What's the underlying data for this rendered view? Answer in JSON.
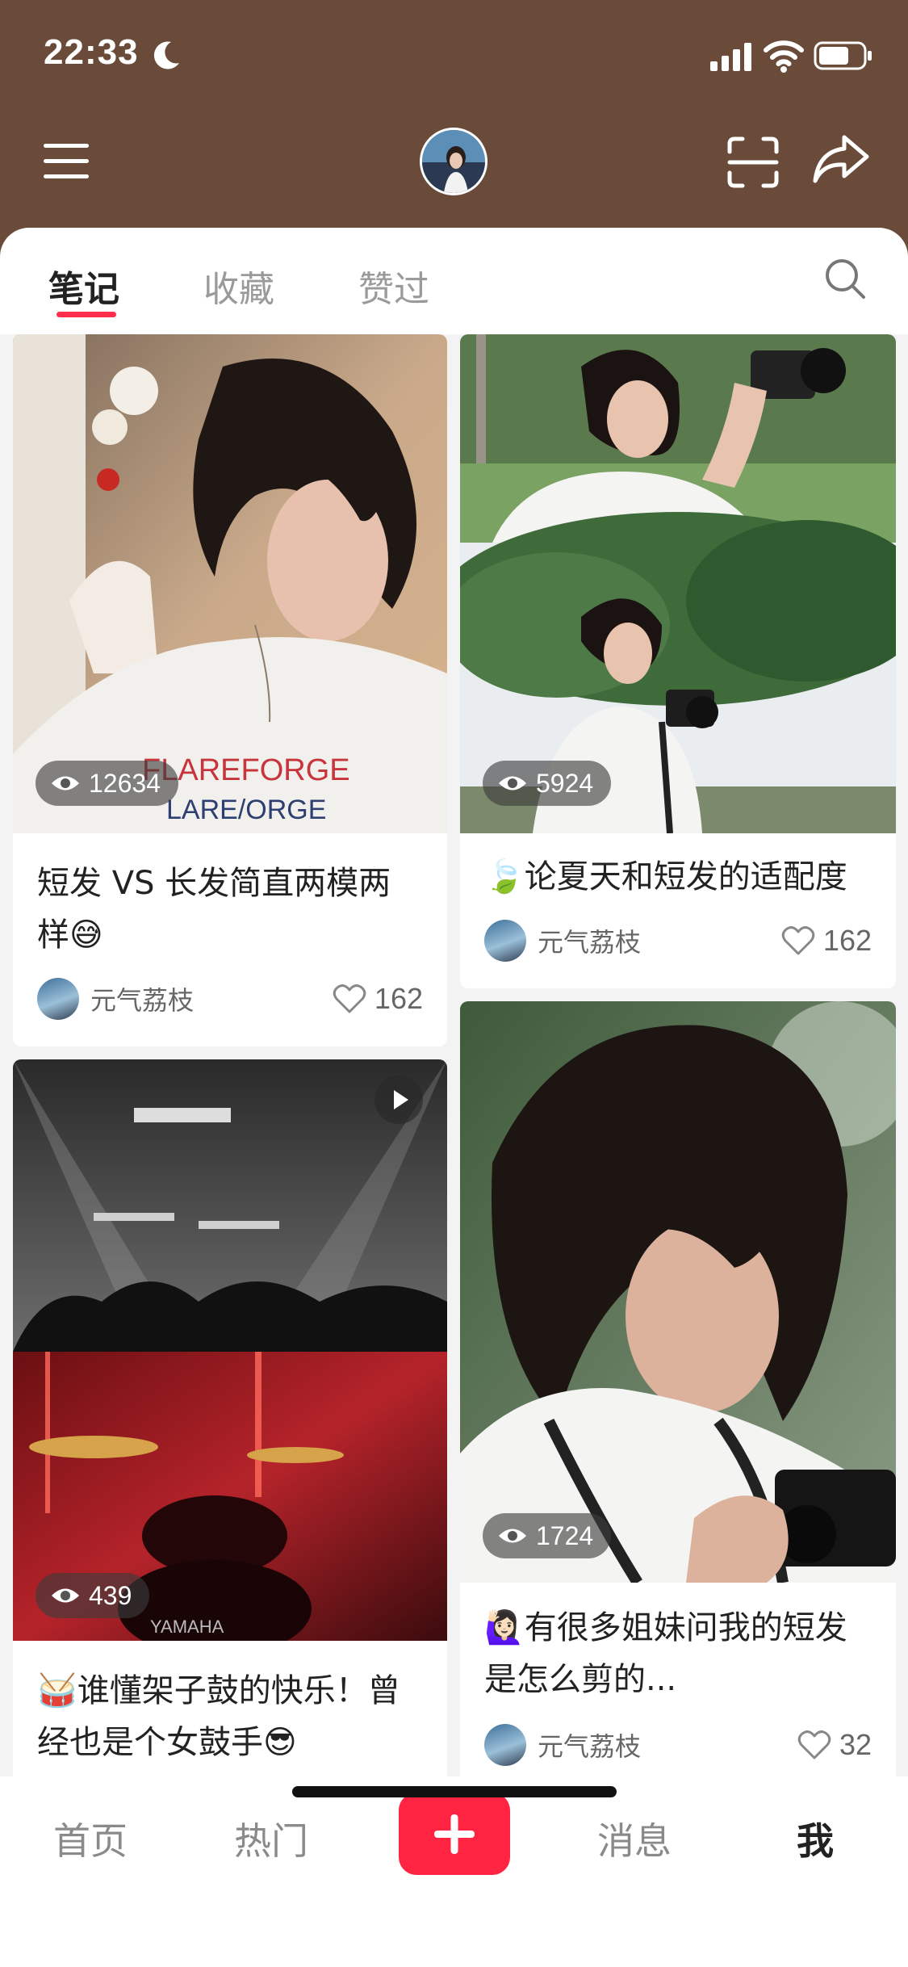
{
  "status_bar": {
    "time": "22:33"
  },
  "tabs": [
    {
      "label": "笔记",
      "active": true
    },
    {
      "label": "收藏",
      "active": false
    },
    {
      "label": "赞过",
      "active": false
    }
  ],
  "cards": [
    {
      "views": "12634",
      "title": "短发 VS 长发简直两模两样😅",
      "author": "元气荔枝",
      "likes": "162"
    },
    {
      "views": "5924",
      "title": "🍃论夏天和短发的适配度",
      "author": "元气荔枝",
      "likes": "162"
    },
    {
      "views": "439",
      "title": "🥁谁懂架子鼓的快乐！曾经也是个女鼓手😎",
      "has_video": true
    },
    {
      "views": "1724",
      "title": "🙋🏻‍♀️有很多姐妹问我的短发是怎么剪的...",
      "author": "元气荔枝",
      "likes": "32"
    }
  ],
  "bottom_nav": [
    {
      "label": "首页",
      "active": false
    },
    {
      "label": "热门",
      "active": false
    },
    {
      "label": "消息",
      "active": false
    },
    {
      "label": "我",
      "active": true
    }
  ],
  "colors": {
    "header_bg": "#6a4b3a",
    "accent": "#ff2442",
    "tab_indicator": "#ff2e4d"
  },
  "photo_text": {
    "shirt_line1": "FLAREFORGE",
    "shirt_line2": "LARE/ORGE",
    "drum_brand": "YAMAHA"
  }
}
